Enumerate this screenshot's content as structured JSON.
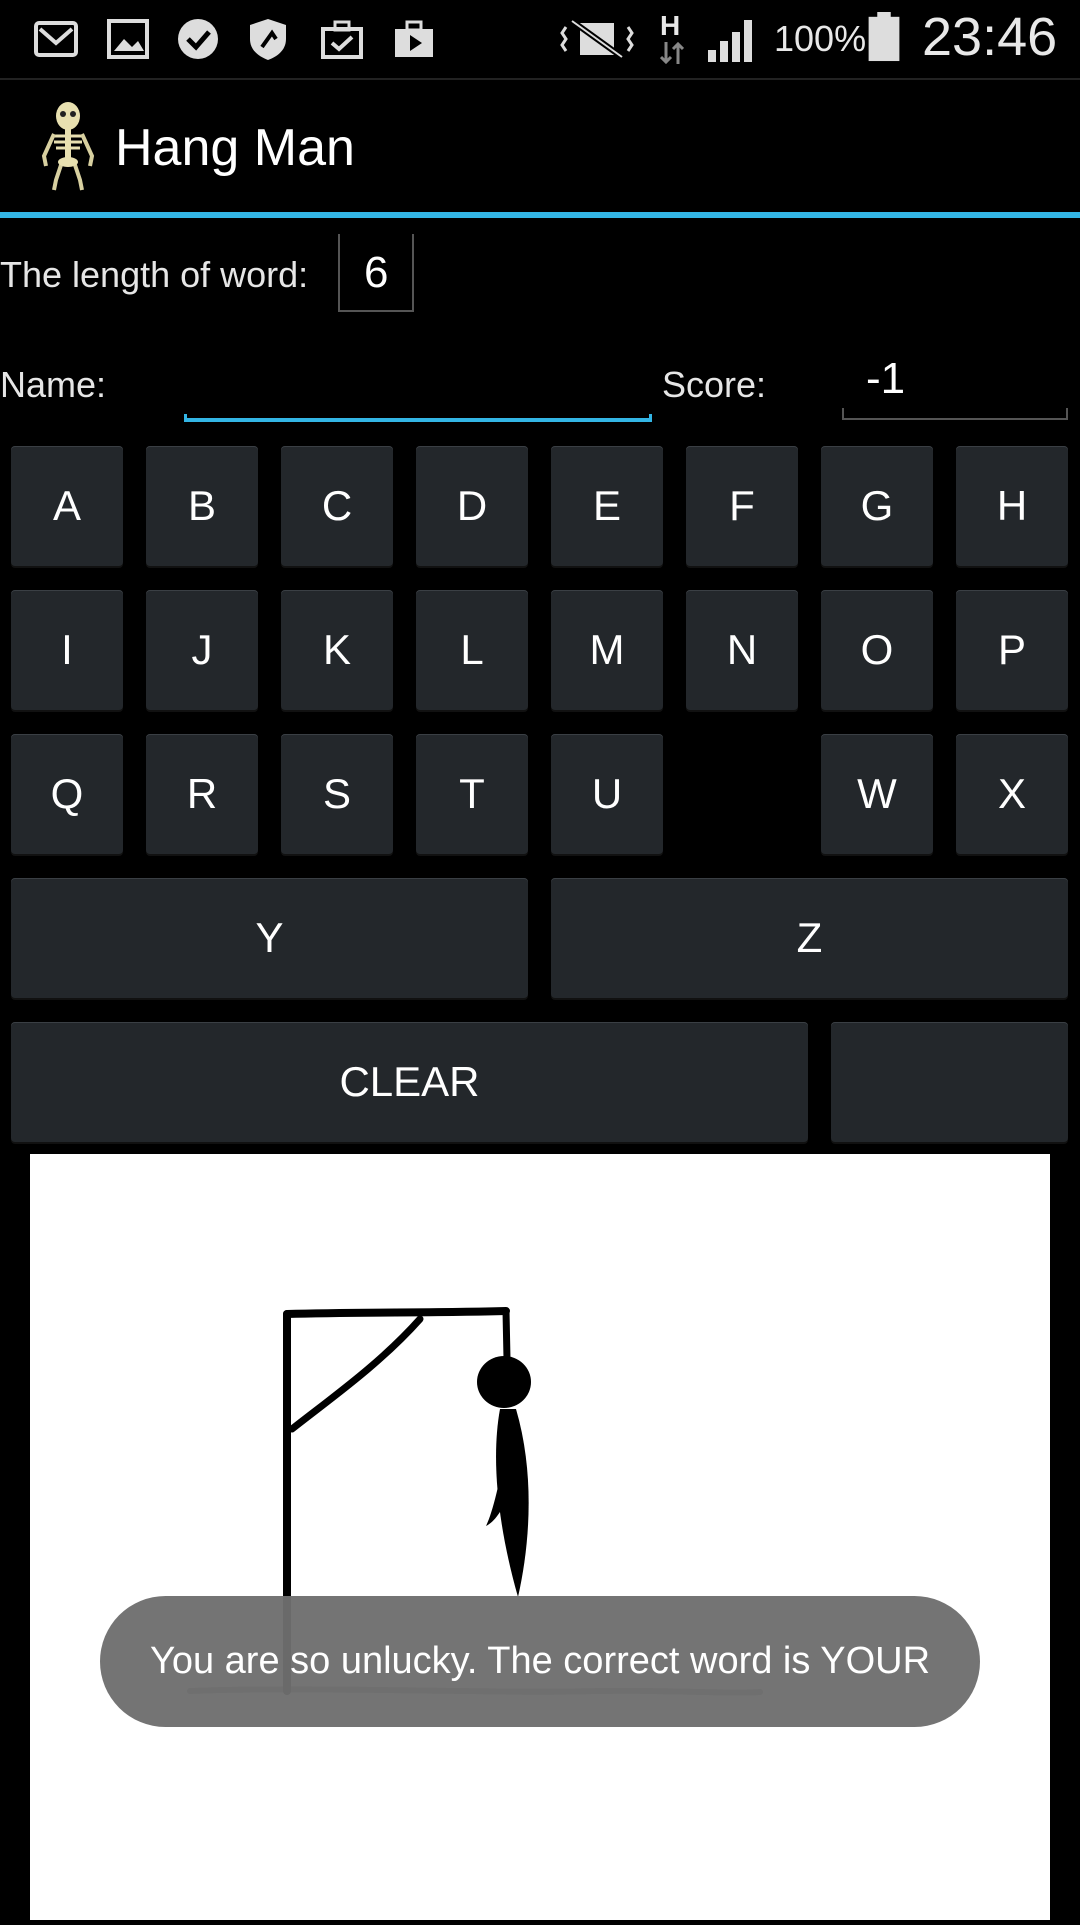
{
  "status_bar": {
    "battery": "100%",
    "time": "23:46",
    "network_type": "H",
    "icons": [
      "gmail-icon",
      "gallery-icon",
      "check-circle-icon",
      "shield-icon",
      "briefcase-check-icon",
      "briefcase-play-icon",
      "vibrate-icon",
      "signal-icon",
      "battery-icon"
    ]
  },
  "app": {
    "title": "Hang Man",
    "icon": "skeleton-icon",
    "accent": "#33b5e5"
  },
  "word_length": {
    "label": "The length of word:",
    "value": "6"
  },
  "name_field": {
    "label": "Name:",
    "value": ""
  },
  "score": {
    "label": "Score:",
    "value": "-1"
  },
  "keyboard": {
    "row1": [
      "A",
      "B",
      "C",
      "D",
      "E",
      "F",
      "G",
      "H"
    ],
    "row2": [
      "I",
      "J",
      "K",
      "L",
      "M",
      "N",
      "O",
      "P"
    ],
    "row3": [
      "Q",
      "R",
      "S",
      "T",
      "U",
      "",
      "W",
      "X"
    ],
    "row4": [
      "Y",
      "Z"
    ],
    "clear_label": "CLEAR",
    "blank_label": ""
  },
  "toast": {
    "message": "You are so unlucky. The correct word is YOUR"
  }
}
